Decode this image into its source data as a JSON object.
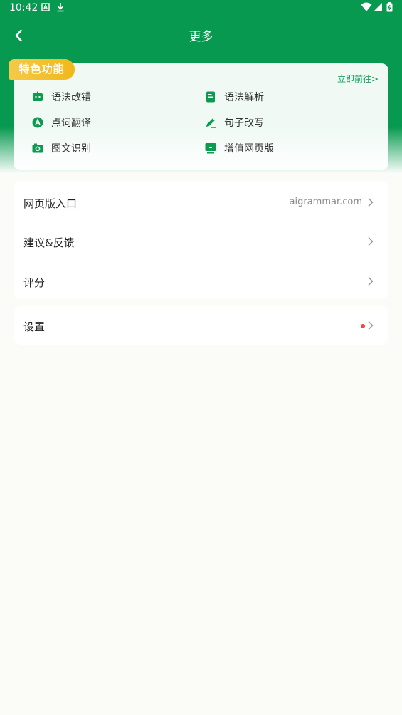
{
  "status_bar": {
    "time": "10:42"
  },
  "nav": {
    "title": "更多"
  },
  "features": {
    "badge": "特色功能",
    "goto": "立即前往>",
    "items": [
      {
        "label": "语法改错",
        "icon": "robot-icon"
      },
      {
        "label": "语法解析",
        "icon": "document-icon"
      },
      {
        "label": "点词翻译",
        "icon": "translate-a-icon"
      },
      {
        "label": "句子改写",
        "icon": "pencil-icon"
      },
      {
        "label": "图文识别",
        "icon": "camera-icon"
      },
      {
        "label": "增值网页版",
        "icon": "monitor-icon"
      }
    ]
  },
  "menu_group_1": [
    {
      "label": "网页版入口",
      "value": "aigrammar.com"
    },
    {
      "label": "建议&反馈"
    },
    {
      "label": "评分"
    }
  ],
  "menu_group_2": [
    {
      "label": "设置",
      "has_notification_dot": true
    }
  ],
  "colors": {
    "brand_green": "#06994f",
    "badge_yellow": "#f3bd28",
    "notification_red": "#f04a3a"
  }
}
